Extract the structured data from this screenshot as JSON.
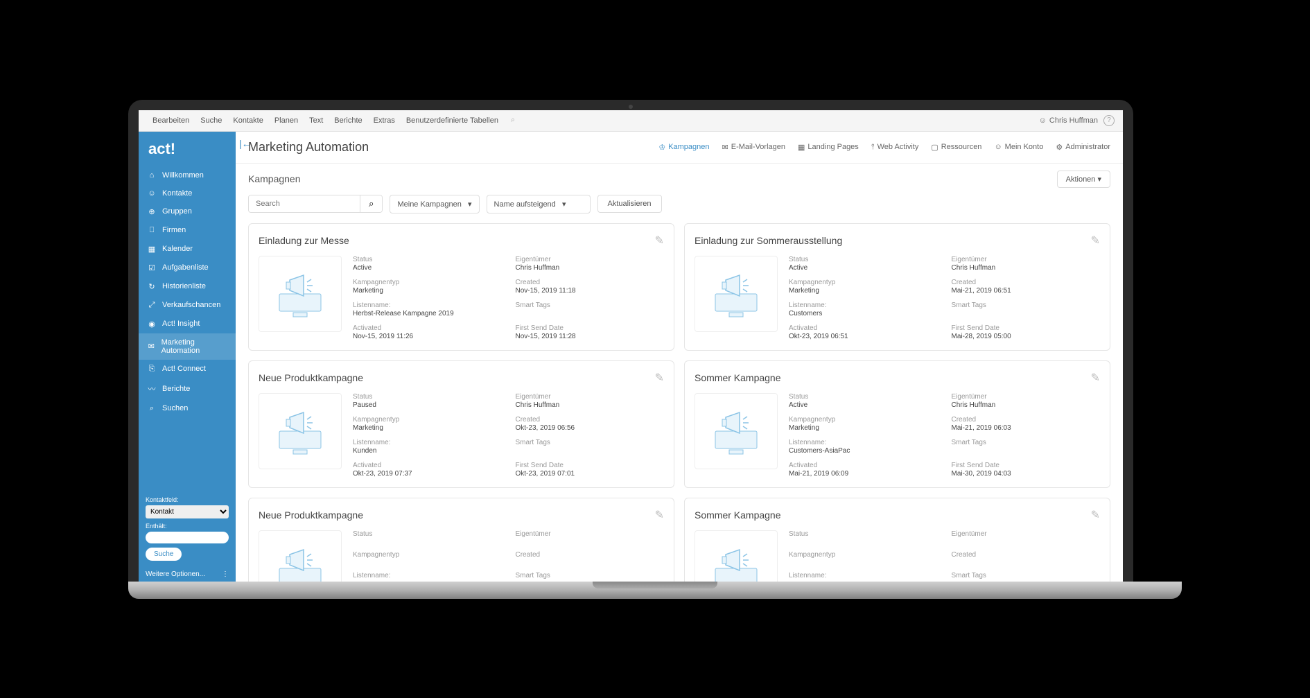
{
  "topMenu": [
    "Bearbeiten",
    "Suche",
    "Kontakte",
    "Planen",
    "Text",
    "Berichte",
    "Extras",
    "Benutzerdefinierte Tabellen"
  ],
  "user": "Chris Huffman",
  "logo": "act!",
  "sidebar": [
    {
      "icon": "⌂",
      "label": "Willkommen"
    },
    {
      "icon": "☺",
      "label": "Kontakte"
    },
    {
      "icon": "⊕",
      "label": "Gruppen"
    },
    {
      "icon": "⎕",
      "label": "Firmen"
    },
    {
      "icon": "▦",
      "label": "Kalender"
    },
    {
      "icon": "☑",
      "label": "Aufgabenliste"
    },
    {
      "icon": "↻",
      "label": "Historienliste"
    },
    {
      "icon": "⤢",
      "label": "Verkaufschancen"
    },
    {
      "icon": "◉",
      "label": "Act! Insight"
    },
    {
      "icon": "✉",
      "label": "Marketing Automation",
      "active": true
    },
    {
      "icon": "⎘",
      "label": "Act! Connect"
    },
    {
      "icon": "〰",
      "label": "Berichte"
    },
    {
      "icon": "⌕",
      "label": "Suchen"
    }
  ],
  "sidebarBottom": {
    "fieldLabel": "Kontaktfeld:",
    "fieldValue": "Kontakt",
    "containsLabel": "Enthält:",
    "searchBtn": "Suche",
    "moreOptions": "Weitere Optionen..."
  },
  "pageTitle": "Marketing Automation",
  "tabs": [
    {
      "label": "Kampagnen",
      "active": true
    },
    {
      "label": "E-Mail-Vorlagen"
    },
    {
      "label": "Landing Pages"
    },
    {
      "label": "Web Activity"
    },
    {
      "label": "Ressourcen"
    },
    {
      "label": "Mein Konto"
    },
    {
      "label": "Administrator"
    }
  ],
  "subTitle": "Kampagnen",
  "actionsBtn": "Aktionen",
  "searchPlaceholder": "Search",
  "filter1": "Meine Kampagnen",
  "filter2": "Name aufsteigend",
  "refreshBtn": "Aktualisieren",
  "labels": {
    "status": "Status",
    "owner": "Eigentümer",
    "type": "Kampagnentyp",
    "created": "Created",
    "list": "Listenname:",
    "tags": "Smart Tags",
    "activated": "Activated",
    "firstSend": "First Send Date"
  },
  "campaigns": [
    {
      "title": "Einladung zur Messe",
      "status": "Active",
      "owner": "Chris Huffman",
      "type": "Marketing",
      "created": "Nov-15, 2019 11:18",
      "list": "Herbst-Release Kampagne 2019",
      "tags": "",
      "activated": "Nov-15, 2019 11:26",
      "firstSend": "Nov-15, 2019 11:28"
    },
    {
      "title": "Einladung zur Sommerausstellung",
      "status": "Active",
      "owner": "Chris Huffman",
      "type": "Marketing",
      "created": "Mai-21, 2019 06:51",
      "list": "Customers",
      "tags": "",
      "activated": "Okt-23, 2019 06:51",
      "firstSend": "Mai-28, 2019 05:00"
    },
    {
      "title": "Neue Produktkampagne",
      "status": "Paused",
      "owner": "Chris Huffman",
      "type": "Marketing",
      "created": "Okt-23, 2019 06:56",
      "list": "Kunden",
      "tags": "",
      "activated": "Okt-23, 2019 07:37",
      "firstSend": "Okt-23, 2019 07:01"
    },
    {
      "title": "Sommer Kampagne",
      "status": "Active",
      "owner": "Chris Huffman",
      "type": "Marketing",
      "created": "Mai-21, 2019 06:03",
      "list": "Customers-AsiaPac",
      "tags": "",
      "activated": "Mai-21, 2019 06:09",
      "firstSend": "Mai-30, 2019 04:03"
    },
    {
      "title": "Neue Produktkampagne",
      "status": "",
      "owner": "",
      "type": "",
      "created": "",
      "list": "",
      "tags": "",
      "activated": "",
      "firstSend": ""
    },
    {
      "title": "Sommer Kampagne",
      "status": "",
      "owner": "",
      "type": "",
      "created": "",
      "list": "",
      "tags": "",
      "activated": "",
      "firstSend": ""
    }
  ]
}
